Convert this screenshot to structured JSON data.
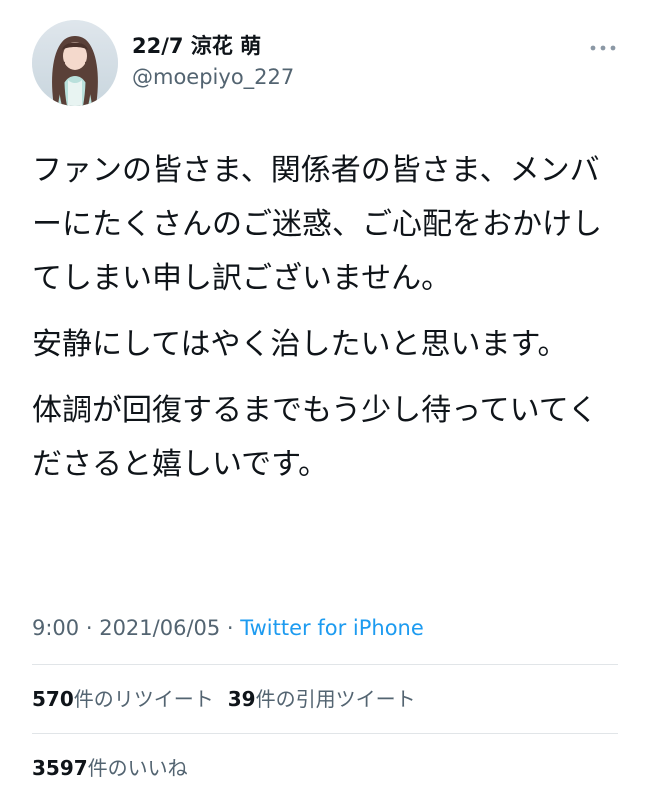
{
  "author": {
    "display_name": "22/7 涼花 萌",
    "handle": "@moepiyo_227"
  },
  "tweet": {
    "paragraphs": [
      "ファンの皆さま、関係者の皆さま、メンバーにたくさんのご迷惑、ご心配をおかけしてしまい申し訳ございません。",
      "安静にしてはやく治したいと思います。",
      "体調が回復するまでもう少し待っていてくださると嬉しいです。"
    ],
    "time": "9:00",
    "separator_1": " · ",
    "date": "2021/06/05",
    "separator_2": " · ",
    "source": "Twitter for iPhone"
  },
  "stats": {
    "retweets_count": "570",
    "retweets_label": "件のリツイート",
    "quotes_count": "39",
    "quotes_label": "件の引用ツイート",
    "likes_count": "3597",
    "likes_label": "件のいいね"
  },
  "icons": {
    "more": "more-dots-icon"
  },
  "colors": {
    "text": "#0f1419",
    "secondary": "#536471",
    "link": "#1d9bf0",
    "divider": "#e1e5e8"
  }
}
